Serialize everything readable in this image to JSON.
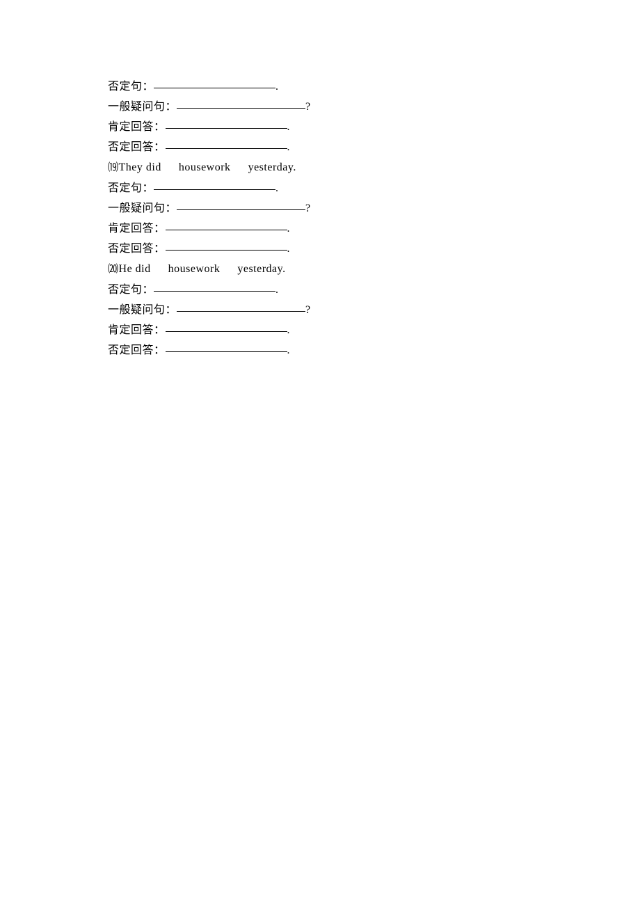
{
  "labels": {
    "neg_sentence": "否定句：",
    "general_question": "一般疑问句：",
    "affirm_answer": "肯定回答：",
    "neg_answer": "否定回答："
  },
  "items": [
    {
      "num": "⒆",
      "sentence_parts": [
        "They did",
        "housework",
        "yesterday."
      ]
    },
    {
      "num": "⒇",
      "sentence_parts": [
        "He did",
        "housework",
        "yesterday."
      ]
    }
  ],
  "punct": {
    "period": ".",
    "question": "?"
  }
}
